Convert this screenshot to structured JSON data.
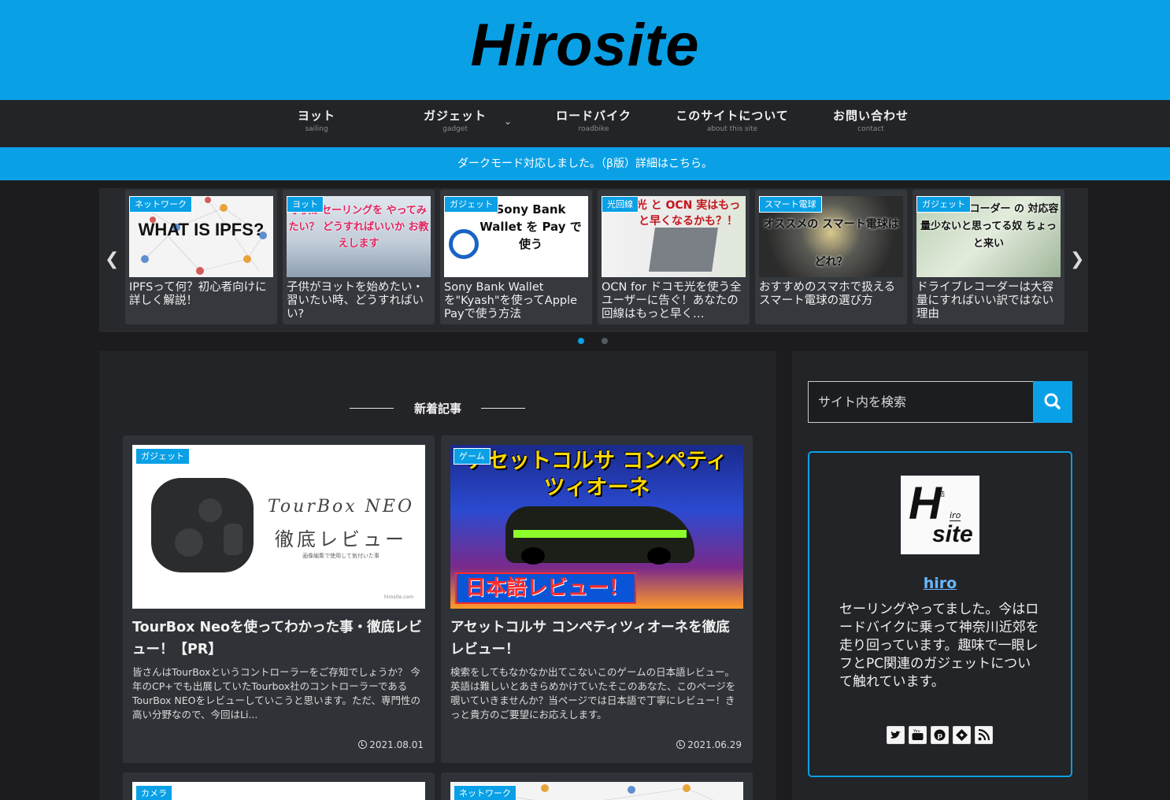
{
  "site": {
    "logo": "Hirosite"
  },
  "nav": [
    {
      "label": "ヨット",
      "sub": "sailing"
    },
    {
      "label": "ガジェット",
      "sub": "gadget"
    },
    {
      "label": "ロードバイク",
      "sub": "roadbike"
    },
    {
      "label": "このサイトについて",
      "sub": "about this site"
    },
    {
      "label": "お問い合わせ",
      "sub": "contact"
    }
  ],
  "notice": "ダークモード対応しました。（β版）詳細はこちら。",
  "slider": {
    "items": [
      {
        "category": "ネットワーク",
        "thumb_text": "WHAT IS IPFS?",
        "title": "IPFSって何？初心者向けに詳しく解説！"
      },
      {
        "category": "ヨット",
        "thumb_text": "子供がセーリングを やってみたい？ どうすればいいか お教えします",
        "title": "子供がヨットを始めたい・習いたい時、どうすればいい?"
      },
      {
        "category": "ガジェット",
        "thumb_text": "Sony Bank Wallet を Pay で使う",
        "title": "Sony Bank Wallet を\"Kyash\"を使ってApple Payで使う方法"
      },
      {
        "category": "光回線",
        "thumb_text": "光 と OCN 実はもっと早くなるかも？！",
        "title": "OCN for ドコモ光を使う全ユーザーに告ぐ！あなたの回線はもっと早く…"
      },
      {
        "category": "スマート電球",
        "thumb_text": "オススメの スマート電球はどれ？",
        "title": "おすすめのスマホで扱えるスマート電球の選び方"
      },
      {
        "category": "ガジェット",
        "thumb_text": "ドライブレコーダー の 対応容量少ないと思ってる奴 ちょっと来い",
        "title": "ドライブレコーダーは大容量にすればいい訳ではない理由"
      }
    ]
  },
  "main": {
    "section_title": "新着記事",
    "cards": [
      {
        "category": "ガジェット",
        "thumb_title": "TourBox NEO",
        "thumb_sub": "徹底レビュー",
        "thumb_small": "画像編集で使用して気付いた事",
        "thumb_url": "hirosite.com",
        "title": "TourBox Neoを使ってわかった事・徹底レビュー！【PR】",
        "excerpt": "皆さんはTourBoxというコントローラーをご存知でしょうか？ 今年のCP+でも出展していたTourbox社のコントローラーであるTourBox NEOをレビューしていこうと思います。ただ、専門性の高い分野なので、今回はLi...",
        "date": "2021.08.01"
      },
      {
        "category": "ゲーム",
        "thumb_title": "アセットコルサ コンペティツィオーネ",
        "thumb_sub": "日本語レビュー！",
        "title": "アセットコルサ コンペティツィオーネを徹底レビュー！",
        "excerpt": "検索をしてもなかなか出てこないこのゲームの日本語レビュー。英語は難しいとあきらめかけていたそこのあなた、このページを覗いていきませんか？当ページでは日本語で丁寧にレビュー！きっと貴方のご要望にお応えします。",
        "date": "2021.06.29"
      },
      {
        "category": "カメラ"
      },
      {
        "category": "ネットワーク"
      }
    ]
  },
  "sidebar": {
    "search_placeholder": "サイト内を検索",
    "profile": {
      "avatar_h": "H",
      "avatar_iro": "iro",
      "avatar_small": "浩",
      "avatar_site": "site",
      "name": "hiro",
      "description": "セーリングやってました。今はロードバイクに乗って神奈川近郊を走り回っています。趣味で一眼レフとPC関連のガジェットについて触れています。"
    }
  },
  "colors": {
    "accent": "#0aa0e6",
    "background": "#1c1c1e",
    "panel": "#232428",
    "card": "#2f3236"
  }
}
